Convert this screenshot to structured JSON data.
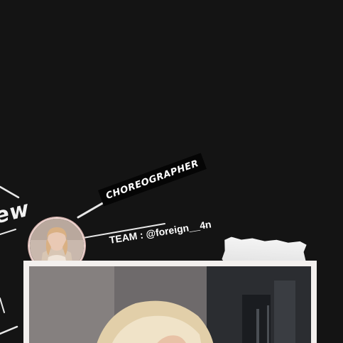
{
  "profile": {
    "role_label": "CHOREOGRAPHER",
    "team_label": "TEAM : @foreign__4n",
    "left_script_fragment": "ew"
  },
  "colors": {
    "background": "#141414",
    "text": "#ffffff",
    "avatar_ring": "#f1d7d3",
    "frame": "#f3f0ee"
  }
}
